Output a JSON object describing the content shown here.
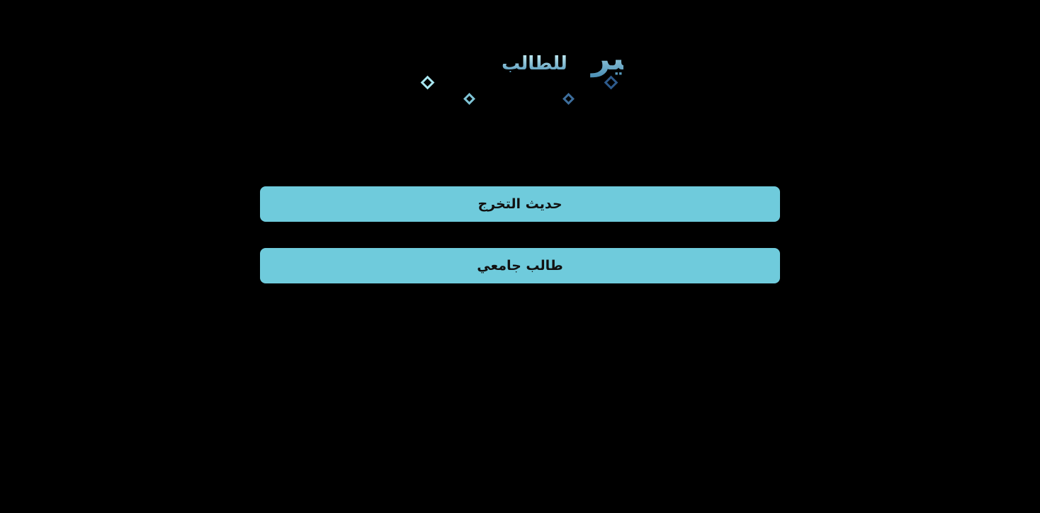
{
  "logo": {
    "main_text": "تيسير",
    "sub_text": "للطالب",
    "gradient_start": "#a8e6ef",
    "gradient_end": "#2d5a8c"
  },
  "options": {
    "recent_graduate_label": "حديث التخرج",
    "university_student_label": "طالب جامعي"
  },
  "colors": {
    "background": "#000000",
    "button": "#6fcbdc",
    "button_text": "#111111"
  }
}
